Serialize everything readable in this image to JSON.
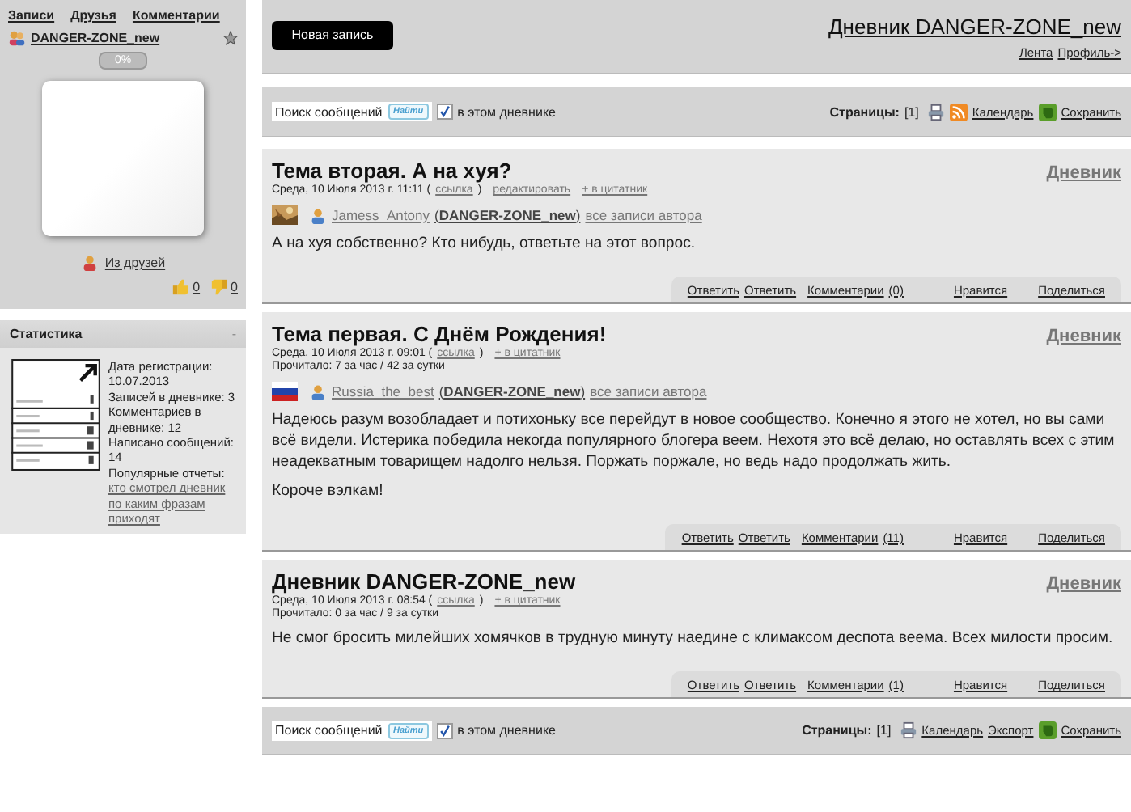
{
  "nav": [
    "Записи",
    "Друзья",
    "Комментарии"
  ],
  "profile": {
    "name": "DANGER-ZONE_new",
    "progress": "0%",
    "friends_link": "Из друзей",
    "likes": "0",
    "dislikes": "0"
  },
  "stats": {
    "title": "Статистика",
    "collapse": "-",
    "lines": [
      "Дата регистрации: 10.07.2013",
      "Записей в дневнике: 3",
      "Комментариев в дневнике: 12",
      "Написано сообщений: 14",
      "Популярные отчеты:"
    ],
    "links": [
      "кто смотрел дневник",
      "по каким фразам приходят"
    ]
  },
  "header": {
    "new_post": "Новая запись",
    "title": "Дневник DANGER-ZONE_new",
    "links": [
      "Лента",
      "Профиль->"
    ]
  },
  "search_bars": [
    {
      "placeholder": "Поиск сообщений",
      "button": "Найти",
      "checked": true,
      "label": "в этом дневнике",
      "pages_label": "Страницы:",
      "page": "[1]",
      "tools": [
        {
          "kind": "print"
        },
        {
          "kind": "rss",
          "text": "Календарь"
        },
        {
          "kind": "evernote",
          "text": "Сохранить"
        }
      ]
    },
    {
      "placeholder": "Поиск сообщений",
      "button": "Найти",
      "checked": true,
      "label": "в этом дневнике",
      "pages_label": "Страницы:",
      "page": "[1]",
      "tools": [
        {
          "kind": "print"
        },
        {
          "kind": "plain",
          "text": "Календарь"
        },
        {
          "kind": "plain",
          "text": "Экспорт"
        },
        {
          "kind": "evernote",
          "text": "Сохранить"
        }
      ]
    }
  ],
  "posts": [
    {
      "title": "Тема вторая. А на хуя?",
      "diary_link": "Дневник",
      "date": "Среда, 10 Июля 2013 г. 11:11 (",
      "link": "ссылка",
      "link_close": ")",
      "actions": [
        "редактировать",
        "+ в цитатник"
      ],
      "author": {
        "name": "Jamess_Antony",
        "community": "(**DANGER-ZONE_new**)",
        "all_posts": "все записи автора"
      },
      "paragraphs": [
        "А на хуя собственно? Кто нибудь, ответьте на этот вопрос."
      ],
      "footer": [
        "Ответить",
        "Ответить",
        "Комментарии",
        "(0)",
        "Нравится",
        "Поделиться"
      ]
    },
    {
      "title": "Тема первая. С Днём Рождения!",
      "diary_link": "Дневник",
      "date": "Среда, 10 Июля 2013 г. 09:01 (",
      "link": "ссылка",
      "link_close": ")",
      "actions": [
        "+ в цитатник"
      ],
      "reads": "Прочитало: 7 за час / 42 за сутки",
      "author": {
        "avatar": {
          "kind": "flag"
        },
        "name": "Russia_the_best",
        "community": "(**DANGER-ZONE_new**)",
        "all_posts": "все записи автора"
      },
      "paragraphs": [
        "Надеюсь разум возобладает и потихоньку все перейдут в новое сообщество. Конечно я этого не хотел, но вы сами всё видели. Истерика победила некогда популярного блогера веем. Нехотя это всё делаю, но оставлять всех с этим неадекватным товарищем надолго нельзя. Поржать поржале, но ведь надо продолжать жить.",
        "Короче вэлкам!"
      ],
      "footer": [
        "Ответить",
        "Ответить",
        "Комментарии",
        "(11)",
        "Нравится",
        "Поделиться"
      ]
    },
    {
      "title": "Дневник DANGER-ZONE_new",
      "diary_link": "Дневник",
      "date": "Среда, 10 Июля 2013 г. 08:54 (",
      "link": "ссылка",
      "link_close": ")",
      "actions": [
        "+ в цитатник"
      ],
      "reads": "Прочитало: 0 за час / 9 за сутки",
      "paragraphs": [
        "Не смог бросить милейших хомячков в трудную минуту наедине с климаксом деспота веема. Всех милости просим."
      ],
      "footer": [
        "Ответить",
        "Ответить",
        "Комментарии",
        "(1)",
        "Нравится",
        "Поделиться"
      ]
    }
  ]
}
